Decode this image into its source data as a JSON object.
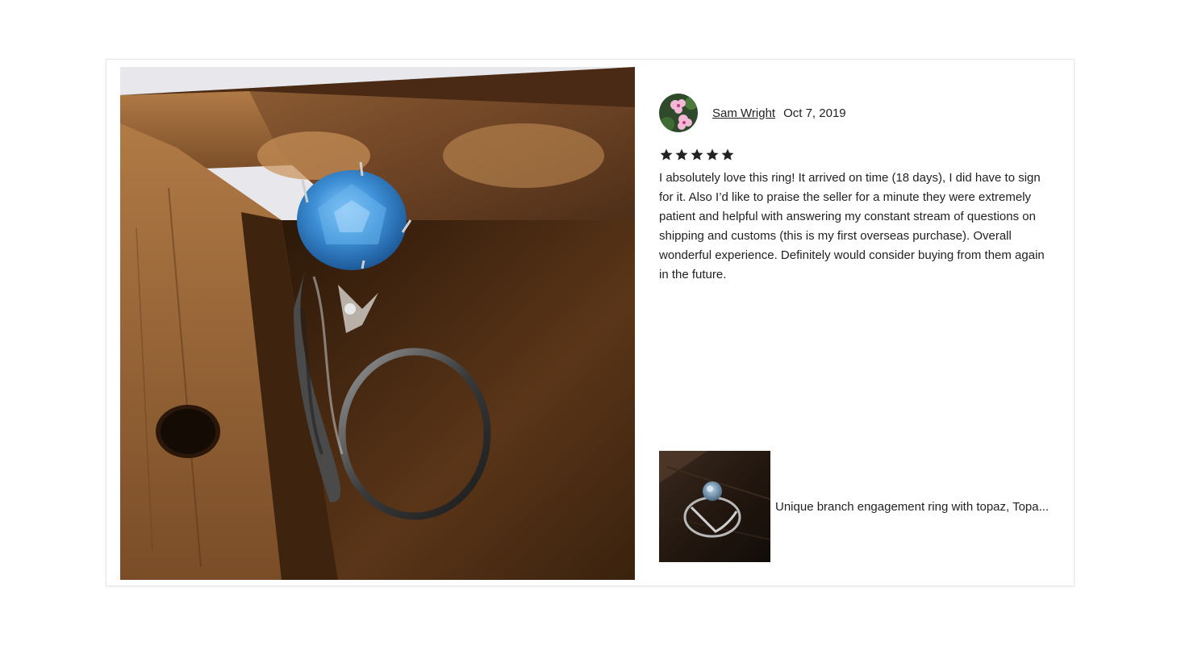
{
  "review": {
    "reviewer_name": "Sam Wright",
    "date": "Oct 7, 2019",
    "rating": 5,
    "rating_max": 5,
    "text": "I absolutely love this ring! It arrived on time (18 days), I did have to sign for it. Also I’d like to praise the seller for a minute they were extremely patient and helpful with answering my constant stream of questions on shipping and customs (this is my first overseas purchase). Overall wonderful experience. Definitely would consider buying from them again in the future."
  },
  "listing": {
    "title": "Unique branch engagement ring with topaz, Topa..."
  },
  "colors": {
    "text": "#222222",
    "star": "#222222",
    "card_border": "#e6e6e6",
    "gem_blue": "#3d8fd6"
  },
  "icons": {
    "star": "star-icon",
    "avatar": "flower-avatar"
  }
}
